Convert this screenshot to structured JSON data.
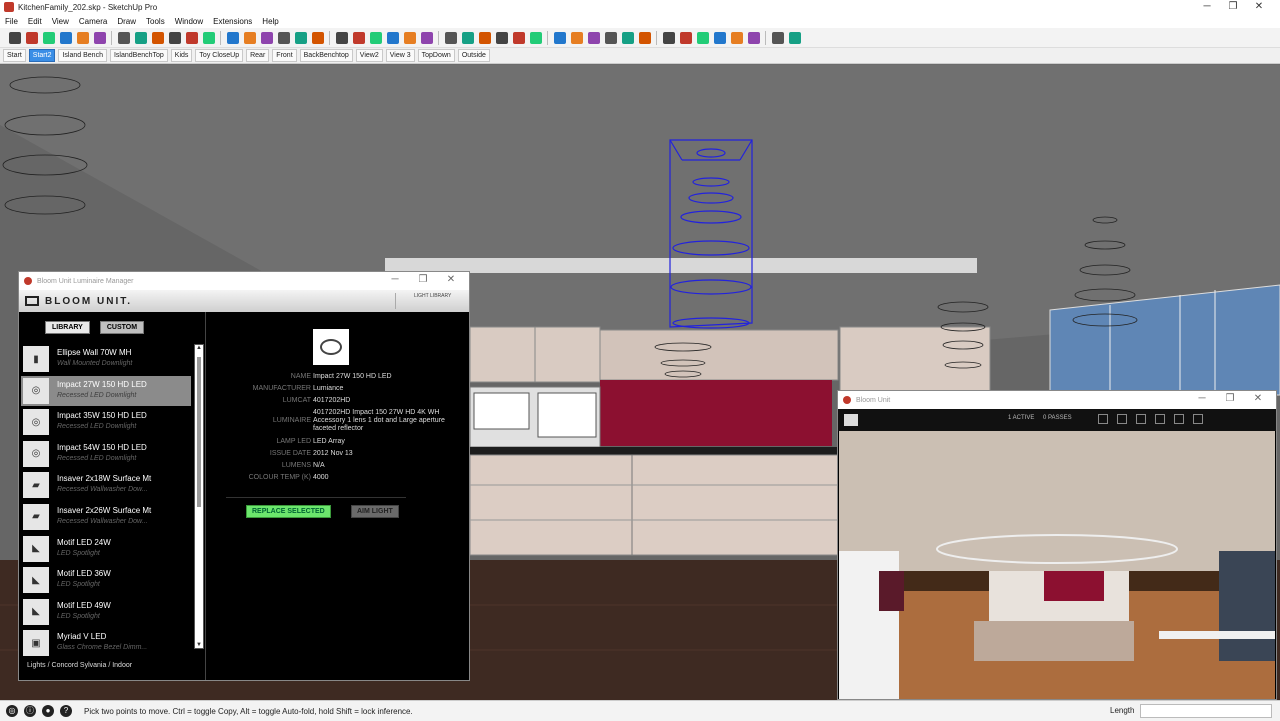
{
  "window": {
    "title": "KitchenFamily_202.skp - SketchUp Pro",
    "controls": [
      "─",
      "❐",
      "✕"
    ]
  },
  "menu": [
    "File",
    "Edit",
    "View",
    "Camera",
    "Draw",
    "Tools",
    "Window",
    "Extensions",
    "Help"
  ],
  "scenes": [
    "Start",
    "Start2",
    "Island Bench",
    "IslandBenchTop",
    "Kids",
    "Toy CloseUp",
    "Rear",
    "Front",
    "BackBenchtop",
    "View2",
    "View 3",
    "TopDown",
    "Outside"
  ],
  "active_scene": "Start2",
  "luminaire_manager": {
    "title": "Bloom Unit Luminaire Manager",
    "brand": "BLOOM UNIT.",
    "light_library": "LIGHT LIBRARY",
    "tabs": [
      "LIBRARY",
      "CUSTOM"
    ],
    "items": [
      {
        "name": "Ellipse Wall 70W MH",
        "sub": "Wall Mounted Downlight"
      },
      {
        "name": "Impact 27W 150 HD LED",
        "sub": "Recessed LED Downlight"
      },
      {
        "name": "Impact 35W 150 HD LED",
        "sub": "Recessed LED Downlight"
      },
      {
        "name": "Impact 54W 150 HD LED",
        "sub": "Recessed LED Downlight"
      },
      {
        "name": "Insaver 2x18W Surface Mt",
        "sub": "Recessed Wallwasher Dow..."
      },
      {
        "name": "Insaver 2x26W Surface Mt",
        "sub": "Recessed Wallwasher Dow..."
      },
      {
        "name": "Motif LED 24W",
        "sub": "LED Spotlight"
      },
      {
        "name": "Motif LED 36W",
        "sub": "LED Spotlight"
      },
      {
        "name": "Motif LED 49W",
        "sub": "LED Spotlight"
      },
      {
        "name": "Myriad V LED",
        "sub": "Glass Chrome Bezel Dimm..."
      }
    ],
    "breadcrumb": "Lights / Concord Sylvania / Indoor",
    "details": [
      {
        "label": "NAME",
        "value": "Impact 27W 150 HD LED"
      },
      {
        "label": "MANUFACTURER",
        "value": "Lumiance"
      },
      {
        "label": "LUMCAT",
        "value": "4017202HD"
      },
      {
        "label": "LUMINAIRE",
        "value": "4017202HD Impact 150 27W HD 4K WH Accessory 1 lens 1 dot and Large aperture faceted reflector"
      },
      {
        "label": "LAMP LED",
        "value": "LED Array"
      },
      {
        "label": "ISSUE DATE",
        "value": "2012 Nov 13"
      },
      {
        "label": "LUMENS",
        "value": "N/A"
      },
      {
        "label": "COLOUR TEMP (K)",
        "value": "4000"
      }
    ],
    "actions": {
      "replace": "REPLACE SELECTED",
      "aim": "AIM LIGHT"
    }
  },
  "bloom_unit": {
    "title": "Bloom Unit",
    "stat1": "1 ACTIVE",
    "stat2": "0 PASSES"
  },
  "status": {
    "text": "Pick two points to move.  Ctrl = toggle Copy, Alt = toggle Auto-fold, hold Shift = lock inference.",
    "length_label": "Length"
  },
  "colors": {
    "accent": "#3a8ee6",
    "replace_button": "#6ce66c",
    "backsplash": "#8c1030",
    "selection_wire": "#2222dd"
  }
}
